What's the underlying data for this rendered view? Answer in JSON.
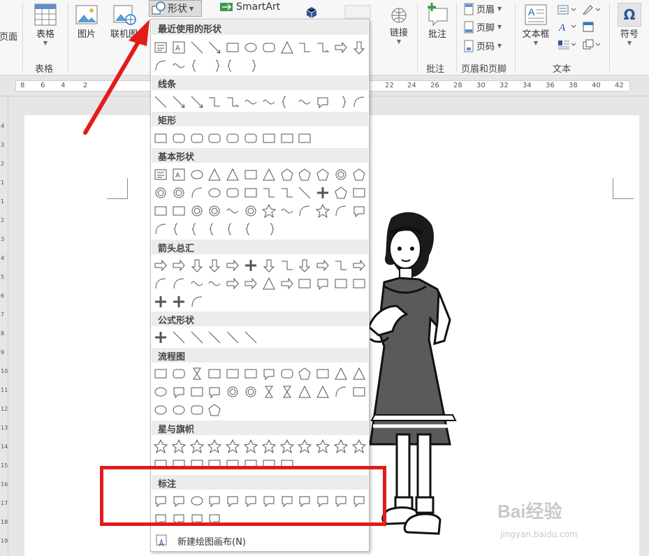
{
  "ribbon": {
    "page_label": "页面",
    "table_label": "表格",
    "table_group": "表格",
    "picture_label": "图片",
    "online_picture_label": "联机图",
    "shapes_label": "形状",
    "smartart_label": "SmartArt",
    "link_label": "链接",
    "comment_label": "批注",
    "comment_group": "批注",
    "header_label": "页眉",
    "footer_label": "页脚",
    "pagenum_label": "页码",
    "header_footer_group": "页眉和页脚",
    "textbox_label": "文本框",
    "text_group": "文本",
    "symbol_label": "符号"
  },
  "ruler": {
    "left_numbers": [
      "8",
      "6",
      "4",
      "2"
    ],
    "right_numbers": [
      "22",
      "24",
      "26",
      "28",
      "30",
      "32",
      "34",
      "36",
      "38",
      "40",
      "42"
    ],
    "vertical_numbers": [
      "4",
      "3",
      "2",
      "1",
      "1",
      "2",
      "3",
      "4",
      "5",
      "6",
      "7",
      "8",
      "9",
      "10",
      "11",
      "12",
      "13",
      "14",
      "15",
      "16",
      "17",
      "18",
      "19"
    ]
  },
  "dropdown": {
    "sections": {
      "recent": "最近使用的形状",
      "lines": "线条",
      "rect": "矩形",
      "basic": "基本形状",
      "arrows": "箭头总汇",
      "equation": "公式形状",
      "flowchart": "流程图",
      "stars": "星与旗帜",
      "callouts": "标注"
    },
    "new_canvas": "新建绘图画布(N)"
  },
  "watermark": {
    "brand": "Bai经验",
    "sub": "jingyan.baidu.com"
  },
  "colors": {
    "highlight": "#e31b1b",
    "ribbon_bg": "#f7f7f7",
    "section_bg": "#ececec",
    "accent": "#2b579a"
  }
}
